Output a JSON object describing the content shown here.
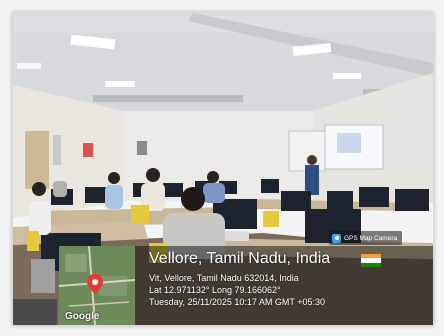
{
  "gps": {
    "app_badge": "GPS Map Camera",
    "place": "Vellore, Tamil Nadu, India",
    "address": "Vit, Vellore, Tamil Nadu 632014, India",
    "coords": "Lat 12.971132° Long 79.166062°",
    "datetime": "Tuesday, 25/11/2025 10:17 AM GMT +05:30",
    "map_brand": "Google",
    "flag_colors": [
      "#ff9933",
      "#ffffff",
      "#138808"
    ]
  }
}
